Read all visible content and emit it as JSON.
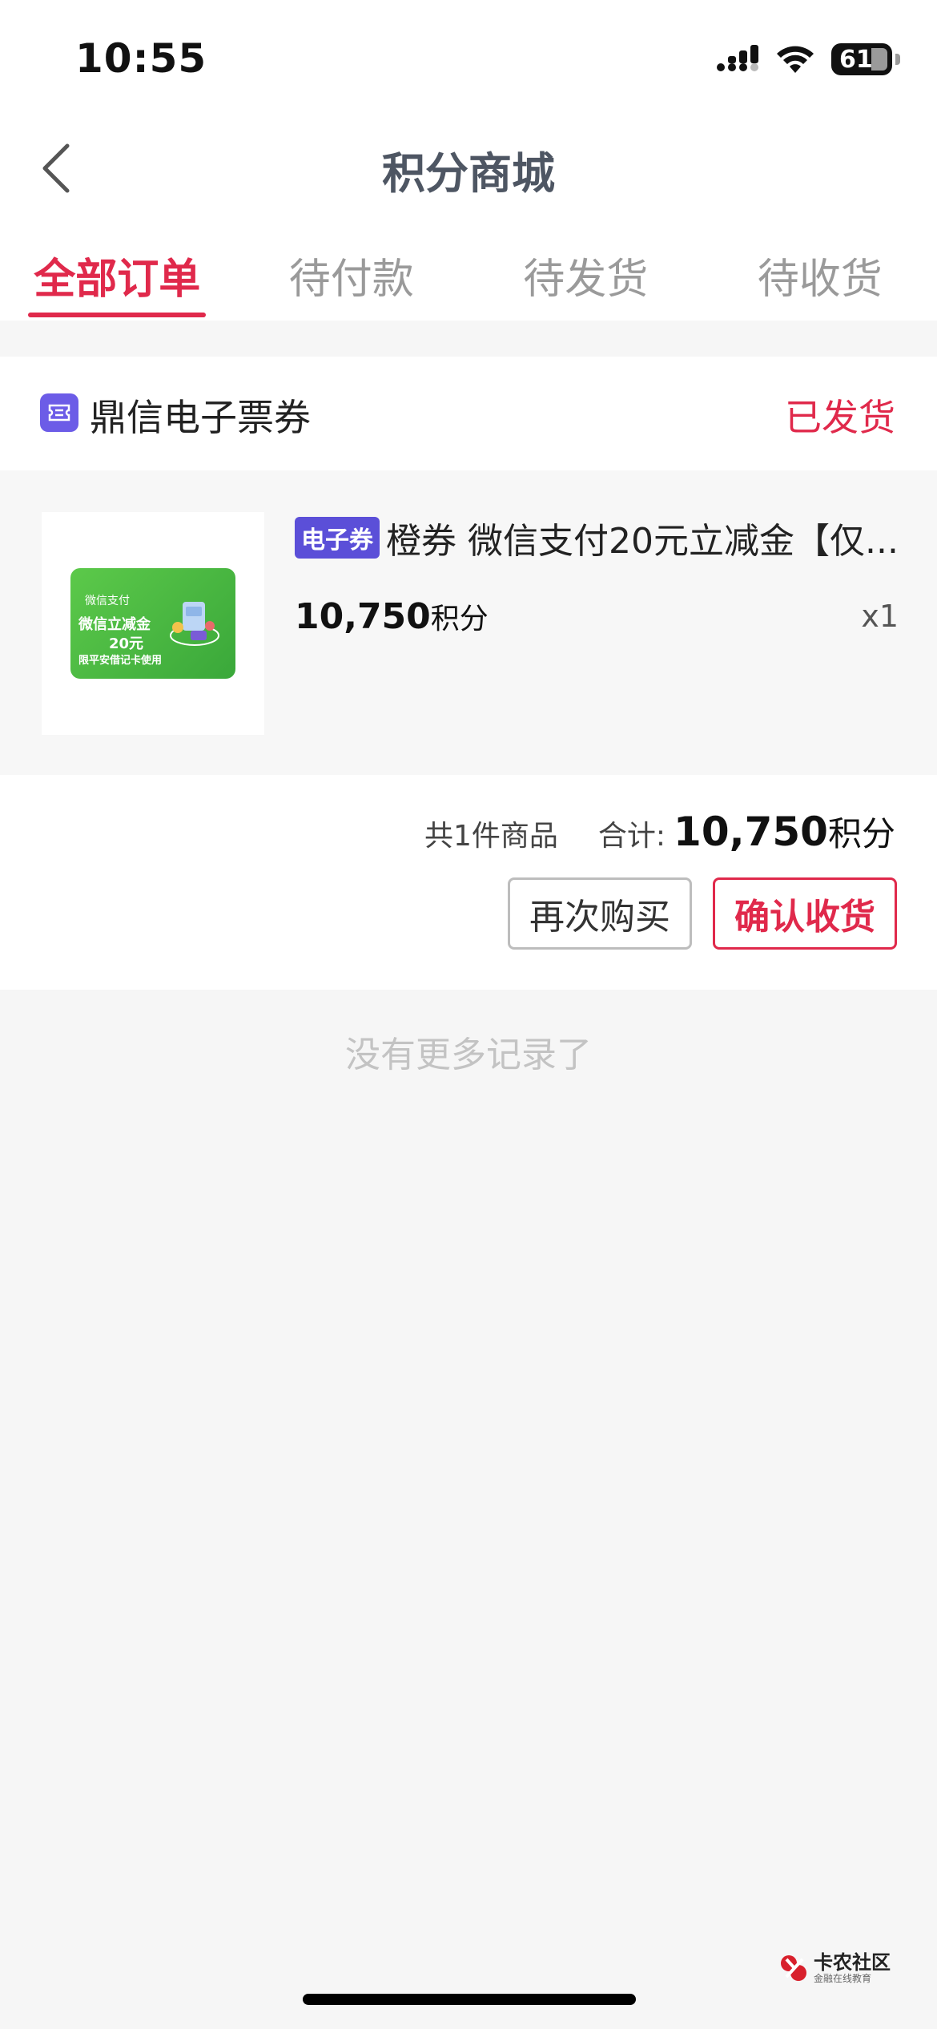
{
  "status_bar": {
    "time": "10:55",
    "battery": "61"
  },
  "header": {
    "title": "积分商城"
  },
  "tabs": [
    {
      "label": "全部订单",
      "active": true
    },
    {
      "label": "待付款",
      "active": false
    },
    {
      "label": "待发货",
      "active": false
    },
    {
      "label": "待收货",
      "active": false
    }
  ],
  "order": {
    "store_name": "鼎信电子票券",
    "status": "已发货",
    "product": {
      "tag": "电子券",
      "name": "橙券 微信支付20元立减金【仅...",
      "price": "10,750",
      "price_unit": "积分",
      "quantity": "x1",
      "thumb_lines": [
        "微信支付",
        "微信立减金",
        "20元",
        "限平安借记卡使用"
      ]
    },
    "summary": {
      "count_text": "共1件商品",
      "total_label": "合计:",
      "total_value": "10,750",
      "total_unit": "积分"
    },
    "buttons": {
      "rebuy": "再次购买",
      "confirm": "确认收货"
    }
  },
  "no_more_text": "没有更多记录了",
  "watermark": {
    "main": "卡农社区",
    "sub": "金融在线教育"
  },
  "colors": {
    "accent": "#e0294b",
    "tag": "#5b4fd8",
    "store_icon": "#6c5ce7"
  }
}
